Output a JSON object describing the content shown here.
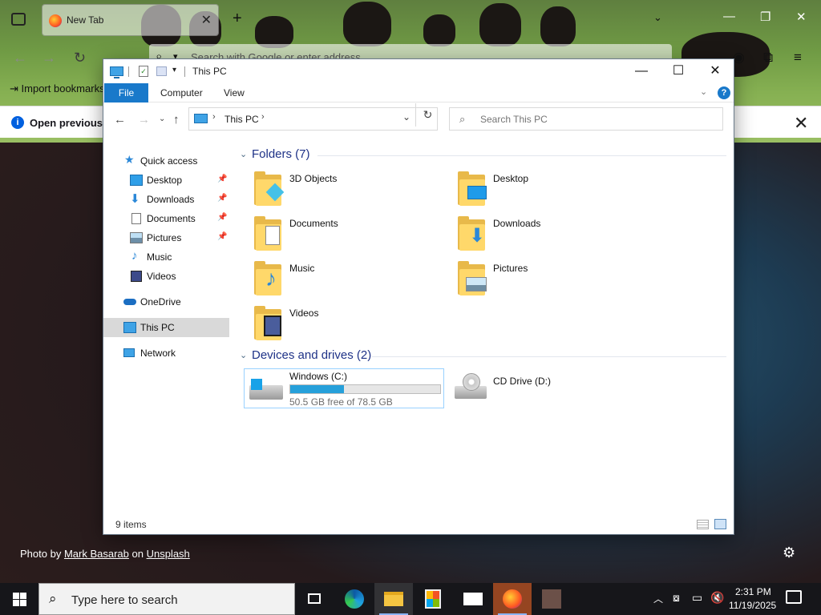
{
  "firefox": {
    "tab_title": "New Tab",
    "urlbar_placeholder": "Search with Google or enter address",
    "bookmarks_label": "Import bookmarks...",
    "notification_text": "Open previous tabs?"
  },
  "photo_credit": {
    "prefix": "Photo by",
    "author": "Mark Basarab",
    "on": "on",
    "site": "Unsplash"
  },
  "explorer": {
    "title": "This PC",
    "ribbon": {
      "file": "File",
      "computer": "Computer",
      "view": "View"
    },
    "address": {
      "location": "This PC"
    },
    "search_placeholder": "Search This PC",
    "nav": {
      "quick_access": "Quick access",
      "items": [
        {
          "label": "Desktop",
          "pinned": true
        },
        {
          "label": "Downloads",
          "pinned": true
        },
        {
          "label": "Documents",
          "pinned": true
        },
        {
          "label": "Pictures",
          "pinned": true
        },
        {
          "label": "Music",
          "pinned": false
        },
        {
          "label": "Videos",
          "pinned": false
        }
      ],
      "onedrive": "OneDrive",
      "this_pc": "This PC",
      "network": "Network"
    },
    "folders_header": "Folders (7)",
    "folders": [
      "3D Objects",
      "Desktop",
      "Documents",
      "Downloads",
      "Music",
      "Pictures",
      "Videos"
    ],
    "devices_header": "Devices and drives (2)",
    "drives": [
      {
        "name": "Windows (C:)",
        "free_text": "50.5 GB free of 78.5 GB",
        "used_fraction": 0.357
      },
      {
        "name": "CD Drive (D:)"
      }
    ],
    "status": "9 items"
  },
  "taskbar": {
    "search_placeholder": "Type here to search",
    "time": "2:31 PM",
    "date": "11/19/2025"
  },
  "colors": {
    "accent": "#1979ca",
    "folder": "#ffd86a",
    "drive_bar": "#26a0da",
    "selection": "#d9d9d9"
  }
}
